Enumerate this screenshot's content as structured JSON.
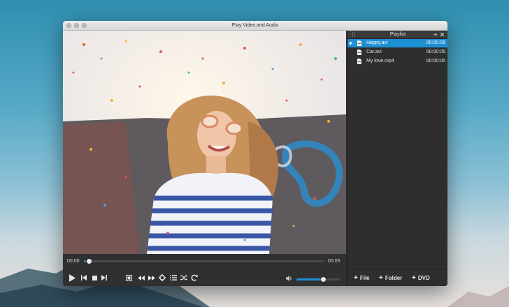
{
  "window": {
    "title": "Play Video and Audio"
  },
  "player": {
    "current_time": "00:00",
    "total_time": "00:05",
    "progress": 0.01,
    "volume": 0.62
  },
  "playlist": {
    "title": "Playlist",
    "items": [
      {
        "name": "Happy.avi",
        "duration": "00:00:05",
        "active": true
      },
      {
        "name": "Car.avi",
        "duration": "00:00:05",
        "active": false
      },
      {
        "name": "My love.mp4",
        "duration": "00:00:05",
        "active": false
      }
    ],
    "add_file": "File",
    "add_folder": "Folder",
    "add_dvd": "DVD"
  },
  "colors": {
    "accent": "#1d8fd3",
    "panel": "#2e2e2e",
    "controls": "#303030"
  },
  "icons": [
    "play-icon",
    "previous-icon",
    "stop-icon",
    "next-icon",
    "fullscreen-icon",
    "rewind-icon",
    "fast-forward-icon",
    "settings-icon",
    "list-icon",
    "shuffle-icon",
    "repeat-icon",
    "volume-icon",
    "pin-icon",
    "close-icon",
    "file-icon"
  ]
}
